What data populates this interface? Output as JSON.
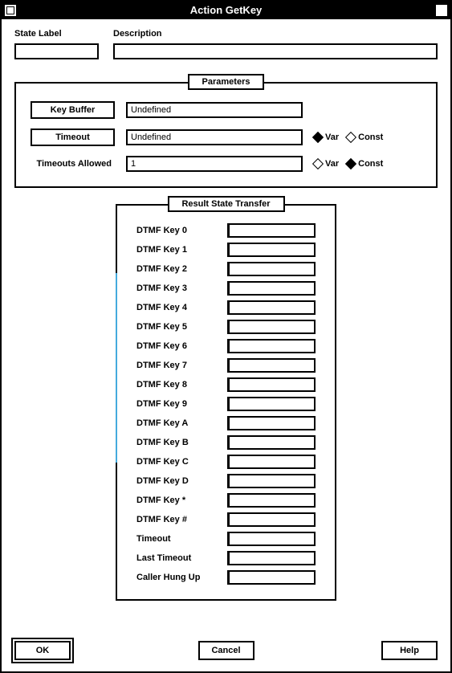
{
  "window": {
    "title": "Action GetKey"
  },
  "top": {
    "state_label": "State Label",
    "state_value": "",
    "description_label": "Description",
    "description_value": ""
  },
  "parameters": {
    "group_label": "Parameters",
    "rows": [
      {
        "label": "Key Buffer",
        "value": "Undefined",
        "boxed_label": true,
        "radios": null
      },
      {
        "label": "Timeout",
        "value": "Undefined",
        "boxed_label": true,
        "radios": {
          "var_label": "Var",
          "const_label": "Const",
          "selected": "var"
        }
      },
      {
        "label": "Timeouts Allowed",
        "value": "1",
        "boxed_label": false,
        "radios": {
          "var_label": "Var",
          "const_label": "Const",
          "selected": "const"
        }
      }
    ]
  },
  "result": {
    "group_label": "Result State Transfer",
    "rows": [
      {
        "label": "DTMF Key 0",
        "value": ""
      },
      {
        "label": "DTMF Key 1",
        "value": ""
      },
      {
        "label": "DTMF Key 2",
        "value": ""
      },
      {
        "label": "DTMF Key 3",
        "value": ""
      },
      {
        "label": "DTMF Key 4",
        "value": ""
      },
      {
        "label": "DTMF Key 5",
        "value": ""
      },
      {
        "label": "DTMF Key 6",
        "value": ""
      },
      {
        "label": "DTMF Key 7",
        "value": ""
      },
      {
        "label": "DTMF Key 8",
        "value": ""
      },
      {
        "label": "DTMF Key 9",
        "value": ""
      },
      {
        "label": "DTMF Key A",
        "value": ""
      },
      {
        "label": "DTMF Key B",
        "value": ""
      },
      {
        "label": "DTMF Key C",
        "value": ""
      },
      {
        "label": "DTMF Key D",
        "value": ""
      },
      {
        "label": "DTMF Key *",
        "value": ""
      },
      {
        "label": "DTMF Key #",
        "value": ""
      },
      {
        "label": "Timeout",
        "value": ""
      },
      {
        "label": "Last Timeout",
        "value": ""
      },
      {
        "label": "Caller Hung Up",
        "value": ""
      }
    ]
  },
  "buttons": {
    "ok": "OK",
    "cancel": "Cancel",
    "help": "Help"
  }
}
